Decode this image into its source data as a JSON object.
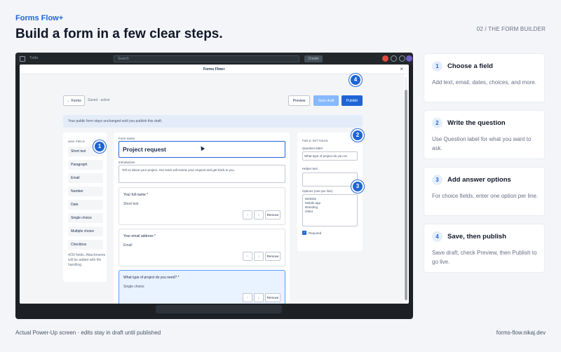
{
  "header": {
    "brand": "Forms Flow+",
    "headline": "Build a form in a few clear steps.",
    "section_tag": "02 / THE FORM BUILDER"
  },
  "footer": {
    "left": "Actual Power-Up screen · edits stay in draft until published",
    "right": "forms-flow.nikaj.dev"
  },
  "trello_bar": {
    "logo": "Trello",
    "search_placeholder": "Search",
    "create_label": "Create"
  },
  "modal": {
    "title": "Forms Flow+",
    "close": "×",
    "back_button": "← Forms",
    "status": "Saved · active",
    "preview_button": "Preview",
    "save_draft_button": "Save draft",
    "publish_button": "Publish",
    "notice": "Your public form stays unchanged until you publish this draft."
  },
  "add_field": {
    "title": "ADD FIELD",
    "items": [
      "Short text",
      "Paragraph",
      "Email",
      "Number",
      "Date",
      "Single choice",
      "Multiple choice",
      "Checkbox"
    ],
    "note": "4/30 fields. Attachments will be added with file handling."
  },
  "form": {
    "name_label": "Form name",
    "name_value": "Project request",
    "intro_label": "Introduction",
    "intro_value": "Tell us about your project. Our team will review your request and get back to you.",
    "cards": [
      {
        "title": "Your full name *",
        "type": "Short text",
        "remove": "Remove"
      },
      {
        "title": "Your email address *",
        "type": "Email",
        "remove": "Remove"
      },
      {
        "title": "What type of project do you need? *",
        "type": "Single choice",
        "remove": "Remove"
      }
    ],
    "up_arrow": "↑",
    "down_arrow": "↓"
  },
  "settings": {
    "title": "FIELD SETTINGS",
    "question_label": "Question label",
    "question_value": "What type of project do you ne",
    "helper_label": "Helper text",
    "options_label": "Options (one per line)",
    "options": [
      "Website",
      "Mobile app",
      "Branding",
      "Other"
    ],
    "required_label": "Required"
  },
  "badges": [
    "1",
    "2",
    "3",
    "4"
  ],
  "steps": [
    {
      "num": "1",
      "title": "Choose a field",
      "desc": "Add text, email, dates, choices, and more."
    },
    {
      "num": "2",
      "title": "Write the question",
      "desc": "Use Question label for what you want to ask."
    },
    {
      "num": "3",
      "title": "Add answer options",
      "desc": "For choice fields, enter one option per line."
    },
    {
      "num": "4",
      "title": "Save, then publish",
      "desc": "Save draft, check Preview, then Publish to go live."
    }
  ],
  "colors": {
    "accent": "#1f65d6",
    "background": "#f3f5f8",
    "dark_frame": "#1d2125"
  }
}
